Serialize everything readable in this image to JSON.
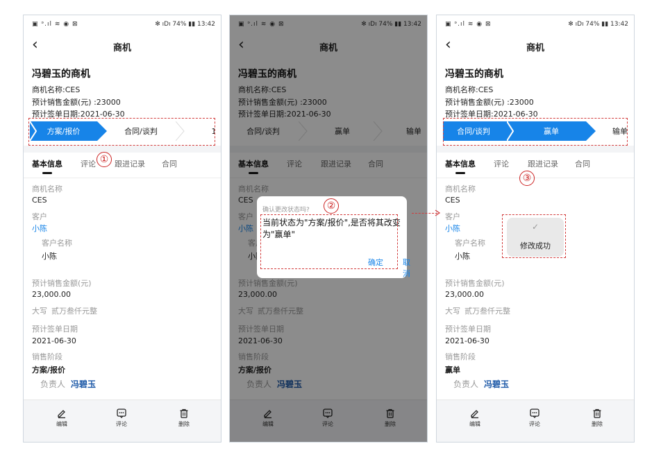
{
  "status_bar": {
    "left": "▣ ᵊ.ıl ≋ ◉ ⊠",
    "right": "✻ ıDı 74% ▮▮ 13:42"
  },
  "nav": {
    "back_icon": "chevron-left-icon",
    "title": "商机"
  },
  "header": {
    "title": "冯碧玉的商机",
    "name_line": "商机名称:CES",
    "amount_line": "预计销售金额(元) :23000",
    "date_line": "预计签单日期:2021-06-30"
  },
  "stages": [
    "方案/报价",
    "合同/谈判",
    "赢单",
    "输单"
  ],
  "stages_partial": {
    "p1_right_cut": "1",
    "p2_right_cut": "输单",
    "p3_right_cut": "输单"
  },
  "tabs": [
    "基本信息",
    "评论",
    "跟进记录",
    "合同"
  ],
  "fields": {
    "name_label": "商机名称",
    "name_value": "CES",
    "customer_label": "客户",
    "customer_value": "小陈",
    "customer_name_label": "客户名称",
    "customer_name_value": "小陈",
    "amount_label": "预计销售金额(元)",
    "amount_value": "23,000.00",
    "capital_label": "大写",
    "capital_value": "贰万叁仟元整",
    "date_label": "预计签单日期",
    "date_value": "2021-06-30",
    "stage_label": "销售阶段",
    "owner_label": "负责人",
    "owner_value": "冯碧玉"
  },
  "panels": [
    {
      "stage_value": "方案/报价"
    },
    {
      "stage_value": "方案/报价"
    },
    {
      "stage_value": "赢单"
    }
  ],
  "bottom_bar": {
    "edit": "编辑",
    "comment": "评论",
    "delete": "删除",
    "icons": [
      "pencil-icon",
      "comment-icon",
      "trash-icon"
    ]
  },
  "dialog": {
    "hint": "确认更改状态吗?",
    "message": "当前状态为\"方案/报价\",是否将其改变为\"赢单\"",
    "ok": "确定",
    "cancel": "取消"
  },
  "toast": {
    "icon": "check-icon",
    "text": "修改成功"
  },
  "callouts": [
    "①",
    "②",
    "③"
  ],
  "colors": {
    "accent": "#1784e8",
    "annotation": "#d23b3b",
    "owner": "#1e5aa8"
  }
}
